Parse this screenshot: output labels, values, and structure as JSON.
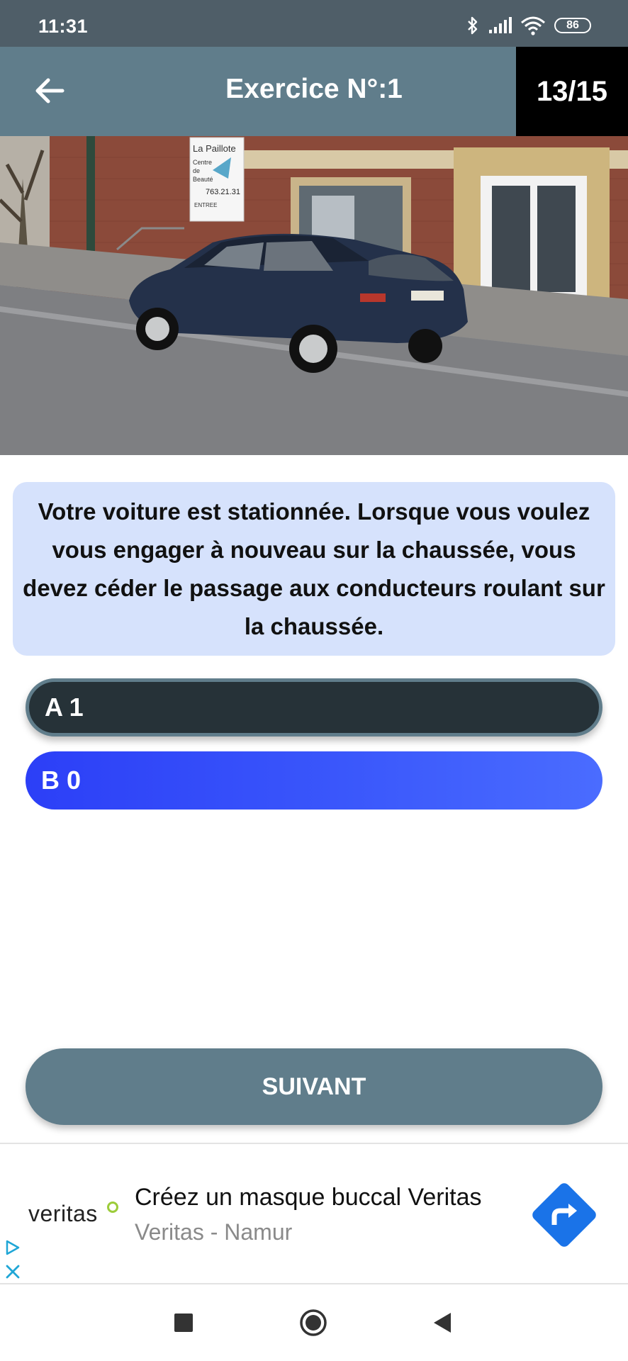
{
  "status_bar": {
    "time": "11:31",
    "battery": "86"
  },
  "header": {
    "title": "Exercice N°:1",
    "counter": "13/15"
  },
  "photo": {
    "sign_lines": [
      "La Paillote",
      "Centre",
      "de",
      "Beauté",
      "763.21.31",
      "ENTREE"
    ]
  },
  "question": {
    "text": "Votre voiture est stationnée. Lorsque vous voulez vous engager à nouveau sur la chaussée, vous devez céder le passage aux conducteurs roulant sur la chaussée."
  },
  "answers": [
    {
      "label": "A 1",
      "state": "selected"
    },
    {
      "label": "B 0",
      "state": "default"
    }
  ],
  "next_button": {
    "label": "SUIVANT"
  },
  "ad": {
    "logo": "veritas",
    "title": "Créez un masque buccal Veritas",
    "subtitle": "Veritas - Namur",
    "cta_icon": "directions-arrow-icon"
  },
  "colors": {
    "status_bar": "#4f5e68",
    "header": "#607d8b",
    "counter_bg": "#000000",
    "question_bg": "#d6e2fc",
    "answer_selected": "#263238",
    "answer_default": "#3a57fb",
    "ad_cta": "#1a73e8"
  }
}
